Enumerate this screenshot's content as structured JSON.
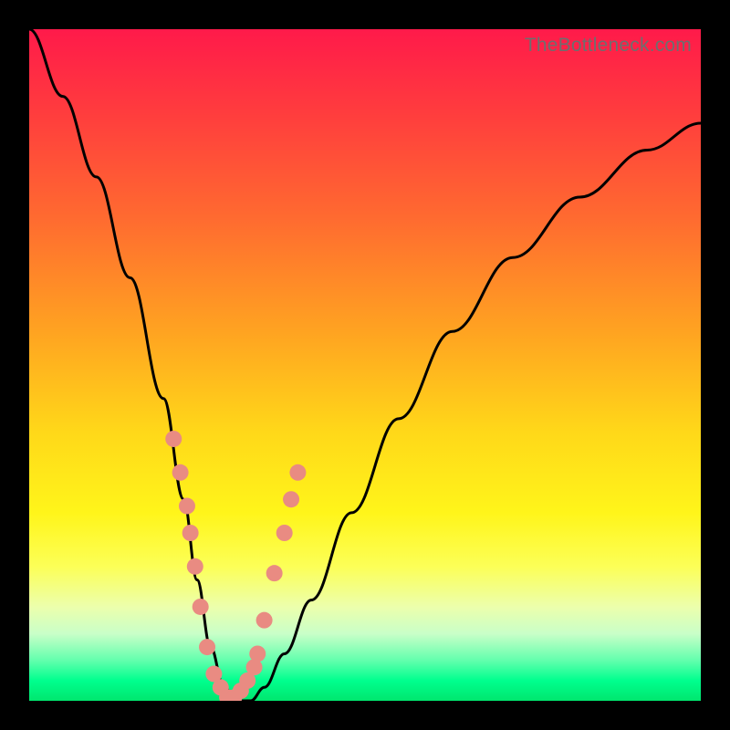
{
  "watermark": "TheBottleneck.com",
  "chart_data": {
    "type": "line",
    "title": "",
    "xlabel": "",
    "ylabel": "",
    "xlim": [
      0,
      100
    ],
    "ylim": [
      0,
      100
    ],
    "x": [
      0,
      5,
      10,
      15,
      20,
      23,
      25,
      27,
      29,
      31,
      33,
      35,
      38,
      42,
      48,
      55,
      63,
      72,
      82,
      92,
      100
    ],
    "values": [
      100,
      90,
      78,
      63,
      45,
      30,
      18,
      8,
      2,
      0,
      0,
      2,
      7,
      15,
      28,
      42,
      55,
      66,
      75,
      82,
      86
    ],
    "series": [
      {
        "name": "bottleneck-curve",
        "color": "#000000"
      },
      {
        "name": "highlight-dots",
        "color": "#e98b82"
      }
    ],
    "highlight_dots_x": [
      21.5,
      22.5,
      23.5,
      24,
      24.7,
      25.5,
      26.5,
      27.5,
      28.5,
      29.5,
      30.5,
      31.5,
      32.5,
      33.5,
      34,
      35,
      36.5,
      38,
      39,
      40
    ],
    "highlight_dots_y": [
      39,
      34,
      29,
      25,
      20,
      14,
      8,
      4,
      2,
      0.5,
      0.5,
      1.5,
      3,
      5,
      7,
      12,
      19,
      25,
      30,
      34
    ]
  }
}
